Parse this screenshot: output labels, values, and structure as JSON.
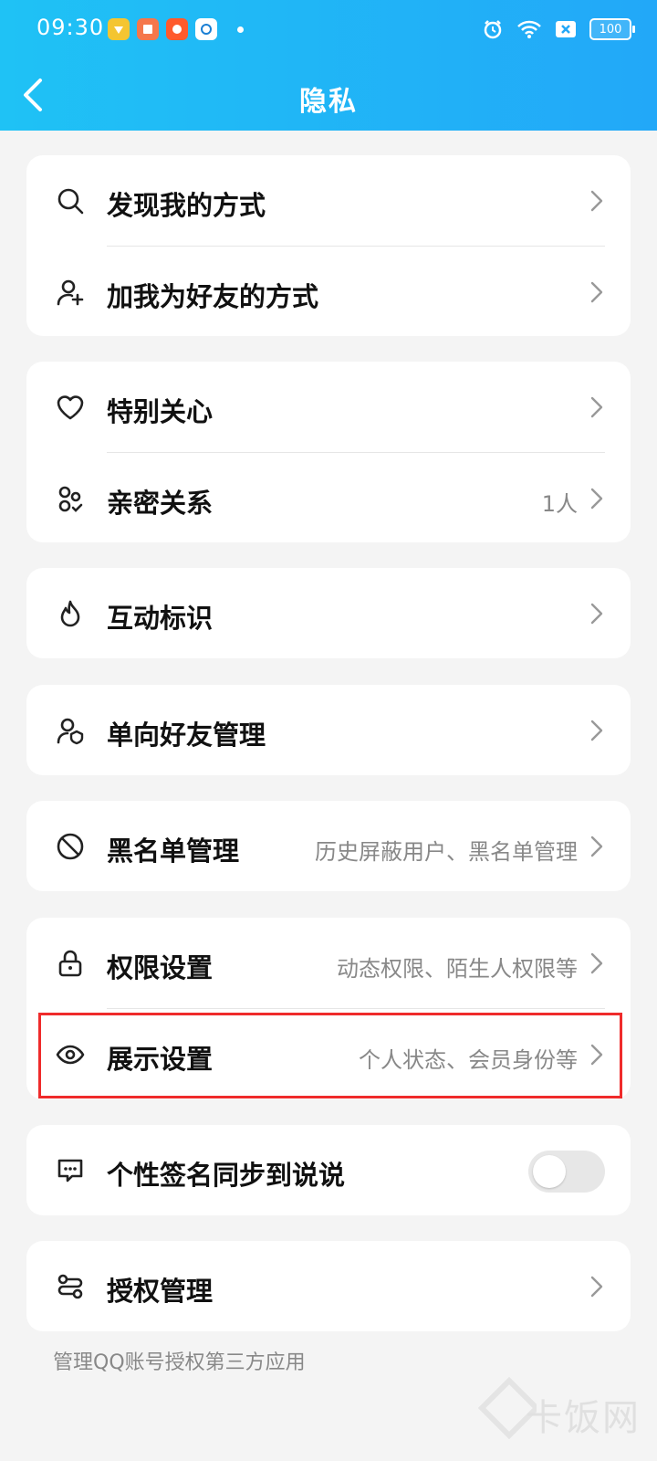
{
  "status_bar": {
    "time": "09:30",
    "battery": "100",
    "apps": [
      "app-1",
      "app-2",
      "app-3",
      "app-4"
    ]
  },
  "nav": {
    "title": "隐私"
  },
  "rows": {
    "discover": {
      "label": "发现我的方式"
    },
    "add_friend": {
      "label": "加我为好友的方式"
    },
    "special_care": {
      "label": "特别关心"
    },
    "intimate": {
      "label": "亲密关系",
      "value": "1人"
    },
    "interaction": {
      "label": "互动标识"
    },
    "one_way": {
      "label": "单向好友管理"
    },
    "blacklist": {
      "label": "黑名单管理",
      "value": "历史屏蔽用户、黑名单管理"
    },
    "permission": {
      "label": "权限设置",
      "value": "动态权限、陌生人权限等"
    },
    "display": {
      "label": "展示设置",
      "value": "个人状态、会员身份等"
    },
    "signature_sync": {
      "label": "个性签名同步到说说",
      "toggle_on": false
    },
    "authorization": {
      "label": "授权管理"
    }
  },
  "footnote": "管理QQ账号授权第三方应用",
  "watermark": "卡饭网",
  "colors": {
    "header": "#22a8f8",
    "highlight": "#ef2b2b",
    "background": "#f4f4f4"
  }
}
